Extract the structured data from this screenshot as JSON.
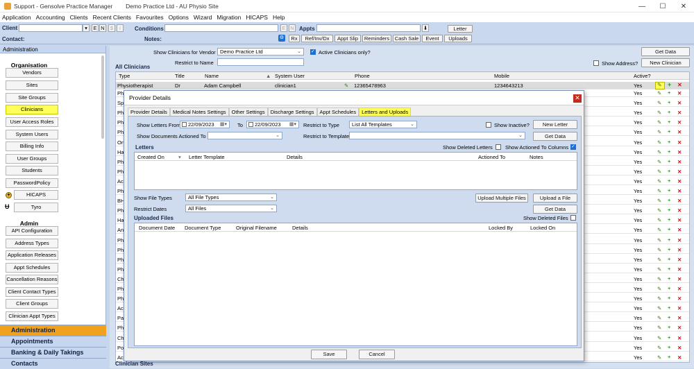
{
  "window": {
    "title": "Support - Gensolve Practice Manager        Demo Practice Ltd - AU Physio Site"
  },
  "menu": [
    "Application",
    "Accounting",
    "Clients",
    "Recent Clients",
    "Favourites",
    "Options",
    "Wizard",
    "Migration",
    "HICAPS",
    "Help"
  ],
  "toolbar": {
    "client_label": "Client",
    "contact_label": "Contact:",
    "conditions_label": "Conditions",
    "notes_label": "Notes:",
    "appts_label": "Appts",
    "small_e": "E",
    "small_n": "N",
    "small_s": "$",
    "small_i": "i",
    "letter_button": "Letter",
    "buttons": [
      "Rx",
      "Ref/Inv/Dx",
      "Appt Slip",
      "Reminders",
      "Cash Sale",
      "Event",
      "Uploads"
    ]
  },
  "left_panel": {
    "header": "Administration",
    "organisation_title": "Organisation",
    "organisation_items": [
      "Vendors",
      "Sites",
      "Site Groups",
      "Clinicians",
      "User Access Roles",
      "System Users",
      "Billing Info",
      "User Groups",
      "Students",
      "PasswordPolicy",
      "HICAPS",
      "Tyro"
    ],
    "selected_item": "Clinicians",
    "admin_title": "Admin",
    "admin_items": [
      "API Configuration",
      "Address Types",
      "Application Releases",
      "Appt Schedules",
      "Cancellation Reasons",
      "Client Contact Types",
      "Client Groups",
      "Clinician Appt Types"
    ],
    "nav": [
      "Administration",
      "Appointments",
      "Banking & Daily Takings",
      "Contacts"
    ],
    "active_nav": "Administration"
  },
  "main": {
    "show_vendor_label": "Show Clinicians for Vendor",
    "vendor_value": "Demo Practice Ltd",
    "active_only_label": "Active Clinicians only?",
    "restrict_label": "Restrict to Name",
    "get_data": "Get Data",
    "show_address_label": "Show Address?",
    "new_clinician": "New Clinician",
    "section_title": "All Clinicians",
    "footer_title": "Clinician Sites",
    "columns": [
      "Type",
      "Title",
      "Name",
      "System User",
      "Phone",
      "Mobile",
      "Active?"
    ],
    "first_row": {
      "type": "Physiotherapist",
      "title": "Dr",
      "name": "Adam  Campbell",
      "system_user": "clinician1",
      "phone": "12365478963",
      "mobile": "1234643213",
      "active": "Yes"
    },
    "row_type_prefixes": [
      "Phy",
      "Spe",
      "Phy",
      "Phy",
      "Phy",
      "Onc",
      "Han",
      "Phy",
      "Phy",
      "Acu",
      "Phy",
      "BH",
      "Phy",
      "Han",
      "Anx",
      "Phy",
      "Phy",
      "Phy",
      "Phy",
      "Chi",
      "Phy",
      "Phy",
      "Acu",
      "Pay",
      "Phy",
      "Chi",
      "Pod",
      "Acu"
    ],
    "active_value": "Yes"
  },
  "dialog": {
    "title": "Provider Details",
    "tabs": [
      "Provider Details",
      "Medical Notes Settings",
      "Other Settings",
      "Discharge Settings",
      "Appt Schedules",
      "Letters and Uploads"
    ],
    "active_tab": "Letters and Uploads",
    "show_letters_from": "Show Letters From",
    "date_from": "22/09/2023",
    "to_label": "To",
    "date_to": "22/09/2023",
    "restrict_type_label": "Restrict to Type",
    "restrict_type_value": "List All Templates",
    "show_inactive_label": "Show Inactive?",
    "new_letter": "New Letter",
    "show_actioned_to": "Show Documents Actioned To",
    "restrict_template_label": "Restrict to Template",
    "get_data": "Get Data",
    "letters_title": "Letters",
    "show_deleted_letters": "Show Deleted Letters",
    "show_actioned_columns": "Show Actioned To Columns",
    "letters_columns": [
      "Created On",
      "Letter Template",
      "Details",
      "Actioned To",
      "Notes"
    ],
    "show_file_types": "Show File Types",
    "file_types_value": "All File Types",
    "restrict_dates": "Restrict Dates",
    "restrict_dates_value": "All Files",
    "upload_multiple": "Upload Multiple Files",
    "upload_file": "Upload a File",
    "uploaded_title": "Uploaded Files",
    "show_deleted_files": "Show Deleted Files",
    "uploaded_columns": [
      "Document Date",
      "Document Type",
      "Original Filename",
      "Details",
      "Locked By",
      "Locked On"
    ],
    "save": "Save",
    "cancel": "Cancel"
  }
}
